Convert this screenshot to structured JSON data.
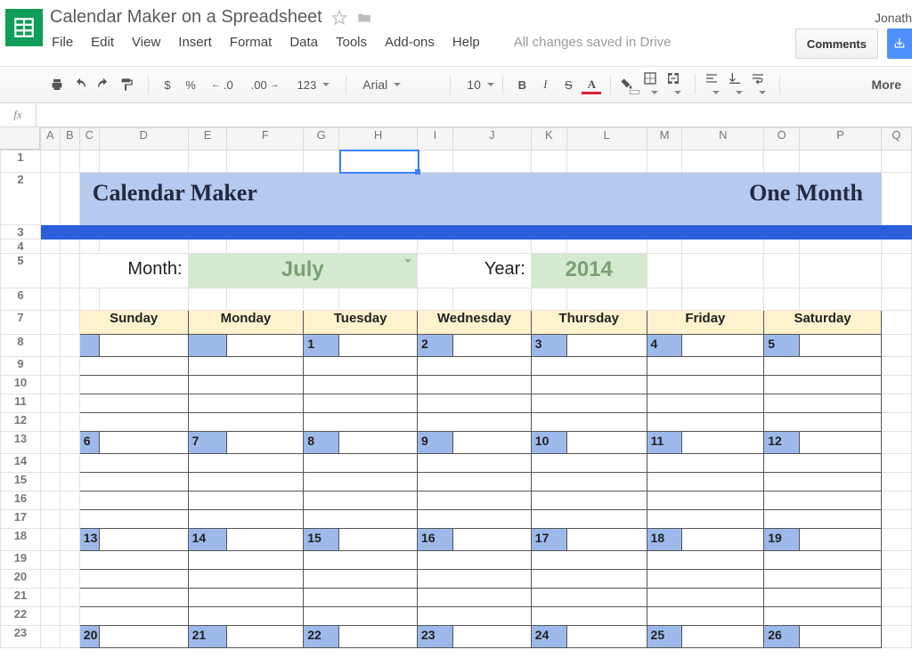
{
  "doc": {
    "title": "Calendar Maker on a Spreadsheet",
    "account": "Jonath",
    "saved_msg": "All changes saved in Drive",
    "comments_label": "Comments",
    "more_label": "More"
  },
  "menu": {
    "items": [
      "File",
      "Edit",
      "View",
      "Insert",
      "Format",
      "Data",
      "Tools",
      "Add-ons",
      "Help"
    ]
  },
  "toolbar": {
    "currency": "$",
    "percent": "%",
    "dec_dec": ".0",
    "dec_inc": ".00",
    "numfmt": "123",
    "font_name": "Arial",
    "font_size": "10",
    "bold": "B",
    "italic": "I",
    "strike": "S",
    "textcolor": "A"
  },
  "formula": {
    "fx": "fx",
    "value": ""
  },
  "columns": [
    "A",
    "B",
    "C",
    "D",
    "E",
    "F",
    "G",
    "H",
    "I",
    "J",
    "K",
    "L",
    "M",
    "N",
    "O",
    "P",
    "Q"
  ],
  "rows": [
    "1",
    "2",
    "3",
    "4",
    "5",
    "6",
    "7",
    "8",
    "9",
    "10",
    "11",
    "12",
    "13",
    "14",
    "15",
    "16",
    "17",
    "18",
    "19",
    "20",
    "21",
    "22",
    "23"
  ],
  "selected_cell": "H1",
  "banner": {
    "left": "Calendar Maker",
    "right": "One Month"
  },
  "controls": {
    "month_label": "Month:",
    "year_label": "Year:",
    "month_value": "July",
    "year_value": "2014"
  },
  "weekdays": [
    "Sunday",
    "Monday",
    "Tuesday",
    "Wednesday",
    "Thursday",
    "Friday",
    "Saturday"
  ],
  "calendar": {
    "weeks": [
      [
        "",
        "",
        "1",
        "2",
        "3",
        "4",
        "5"
      ],
      [
        "6",
        "7",
        "8",
        "9",
        "10",
        "11",
        "12"
      ],
      [
        "13",
        "14",
        "15",
        "16",
        "17",
        "18",
        "19"
      ],
      [
        "20",
        "21",
        "22",
        "23",
        "24",
        "25",
        "26"
      ]
    ],
    "body_rows_per_week": 4
  }
}
